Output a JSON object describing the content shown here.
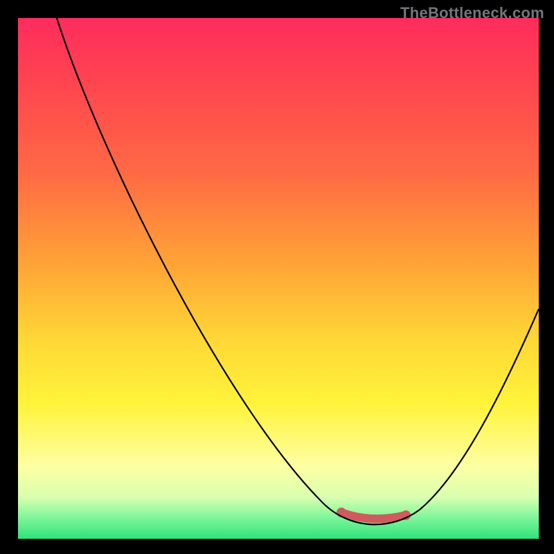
{
  "watermark": "TheBottleneck.com",
  "chart_data": {
    "type": "line",
    "title": "",
    "xlabel": "",
    "ylabel": "",
    "x_range": [
      0,
      1
    ],
    "y_range": [
      0,
      1
    ],
    "description": "Bottleneck curve: monotone descent from top-left to a minimum near x≈0.68, then rises toward the right edge. Y is inverted (lower on screen = better / green).",
    "series": [
      {
        "name": "bottleneck-curve",
        "x": [
          0.07,
          0.15,
          0.25,
          0.35,
          0.45,
          0.55,
          0.62,
          0.68,
          0.74,
          0.82,
          0.9,
          1.0
        ],
        "y": [
          1.0,
          0.8,
          0.6,
          0.42,
          0.27,
          0.14,
          0.07,
          0.03,
          0.05,
          0.15,
          0.3,
          0.44
        ]
      }
    ],
    "highlight_segment": {
      "name": "optimal-range",
      "x": [
        0.62,
        0.74
      ],
      "y": [
        0.05,
        0.05
      ],
      "color": "#cf5b5e"
    },
    "background_gradient": {
      "orientation": "vertical",
      "stops": [
        {
          "pos": 0.0,
          "color": "#ff2c5c"
        },
        {
          "pos": 0.3,
          "color": "#ff6a44"
        },
        {
          "pos": 0.6,
          "color": "#ffd836"
        },
        {
          "pos": 0.85,
          "color": "#feffa2"
        },
        {
          "pos": 1.0,
          "color": "#2ee37a"
        }
      ]
    }
  }
}
